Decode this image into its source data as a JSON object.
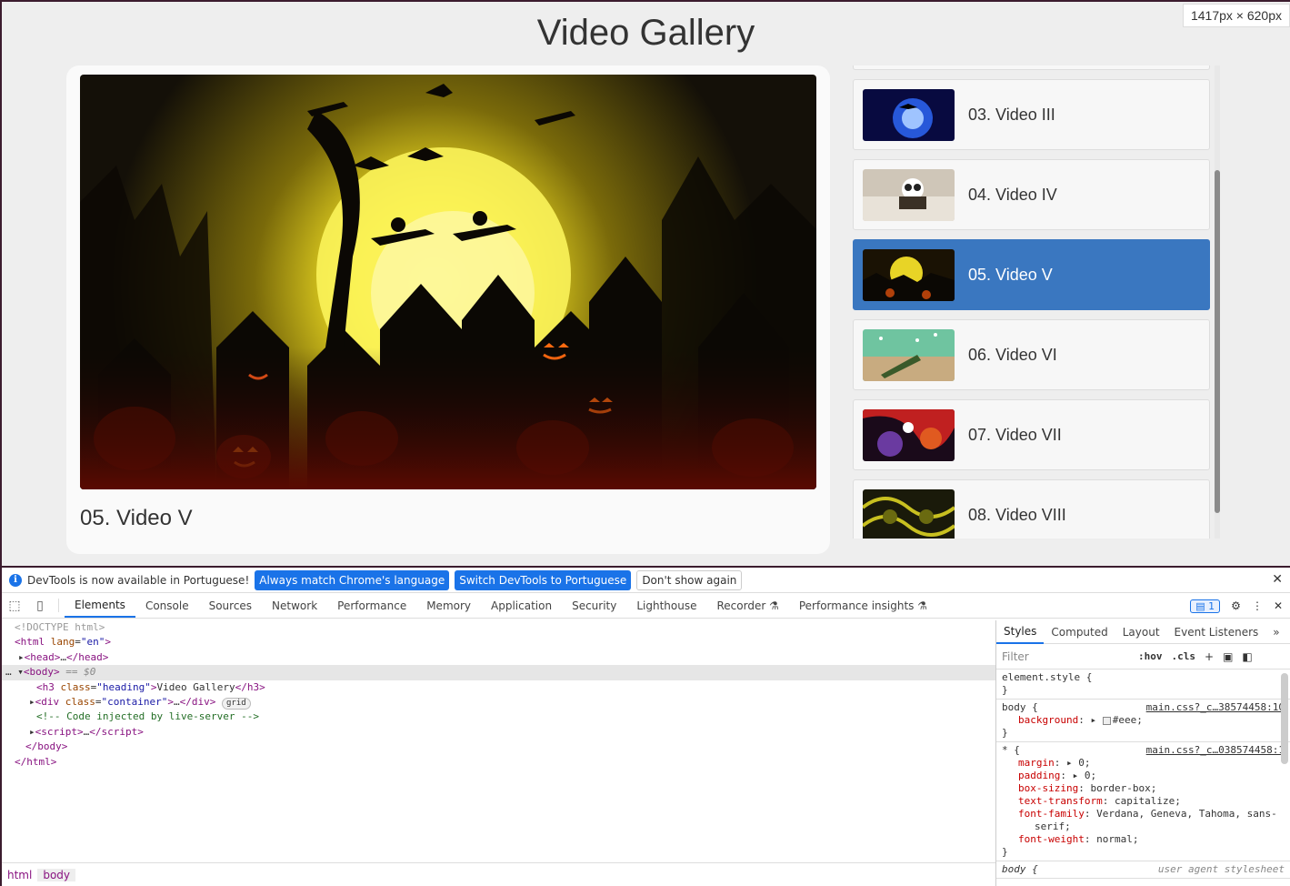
{
  "page": {
    "heading": "Video Gallery",
    "size_badge": "1417px × 620px",
    "current_video_title": "05. Video V"
  },
  "playlist": [
    {
      "label": "03. Video III",
      "thumb": "blue-glow"
    },
    {
      "label": "04. Video IV",
      "thumb": "panda-bed"
    },
    {
      "label": "05. Video V",
      "thumb": "halloween",
      "active": true
    },
    {
      "label": "06. Video VI",
      "thumb": "green-sparkle"
    },
    {
      "label": "07. Video VII",
      "thumb": "colorful-abstract"
    },
    {
      "label": "08. Video VIII",
      "thumb": "gold-pattern"
    }
  ],
  "devtools": {
    "infobar": {
      "message": "DevTools is now available in Portuguese!",
      "btn_match": "Always match Chrome's language",
      "btn_switch": "Switch DevTools to Portuguese",
      "btn_dismiss": "Don't show again"
    },
    "tabs": [
      "Elements",
      "Console",
      "Sources",
      "Network",
      "Performance",
      "Memory",
      "Application",
      "Security",
      "Lighthouse",
      "Recorder ⚗",
      "Performance insights ⚗"
    ],
    "issues_count": "1",
    "dom": {
      "doctype": "<!DOCTYPE html>",
      "html_open_tag": "html",
      "html_lang_attr": "lang",
      "html_lang_val": "\"en\"",
      "head": "head",
      "head_ellipsis": "…",
      "body_tag": "body",
      "body_sel_marker": "== $0",
      "h3_tag": "h3",
      "h3_class_attr": "class",
      "h3_class_val": "\"heading\"",
      "h3_text": "Video Gallery",
      "div_tag": "div",
      "div_class_val": "\"container\"",
      "grid_badge": "grid",
      "comment": "<!-- Code injected by live-server -->",
      "script_tag": "script",
      "body_close": "</body>",
      "html_close": "</html>"
    },
    "breadcrumbs": [
      "html",
      "body"
    ],
    "styles": {
      "tabs": [
        "Styles",
        "Computed",
        "Layout",
        "Event Listeners"
      ],
      "filter_placeholder": "Filter",
      "hov": ":hov",
      "cls": ".cls",
      "element_style": "element.style {",
      "body_selector": "body {",
      "body_src": "main.css?_c…38574458:10",
      "bg_prop": "background",
      "bg_val": "#eee;",
      "star_selector": "* {",
      "star_src": "main.css?_c…038574458:1",
      "star_props": [
        {
          "p": "margin",
          "v": "▸ 0;"
        },
        {
          "p": "padding",
          "v": "▸ 0;"
        },
        {
          "p": "box-sizing",
          "v": "border-box;"
        },
        {
          "p": "text-transform",
          "v": "capitalize;"
        },
        {
          "p": "font-family",
          "v": "Verdana, Geneva, Tahoma, sans-"
        },
        {
          "p": "",
          "v": "serif;"
        },
        {
          "p": "font-weight",
          "v": "normal;"
        }
      ],
      "ua_selector": "body {",
      "ua_label": "user agent stylesheet",
      "close_brace": "}"
    }
  },
  "colors": {
    "active_item": "#3a77c0",
    "page_bg": "#eee",
    "devtools_accent": "#1a73e8"
  }
}
